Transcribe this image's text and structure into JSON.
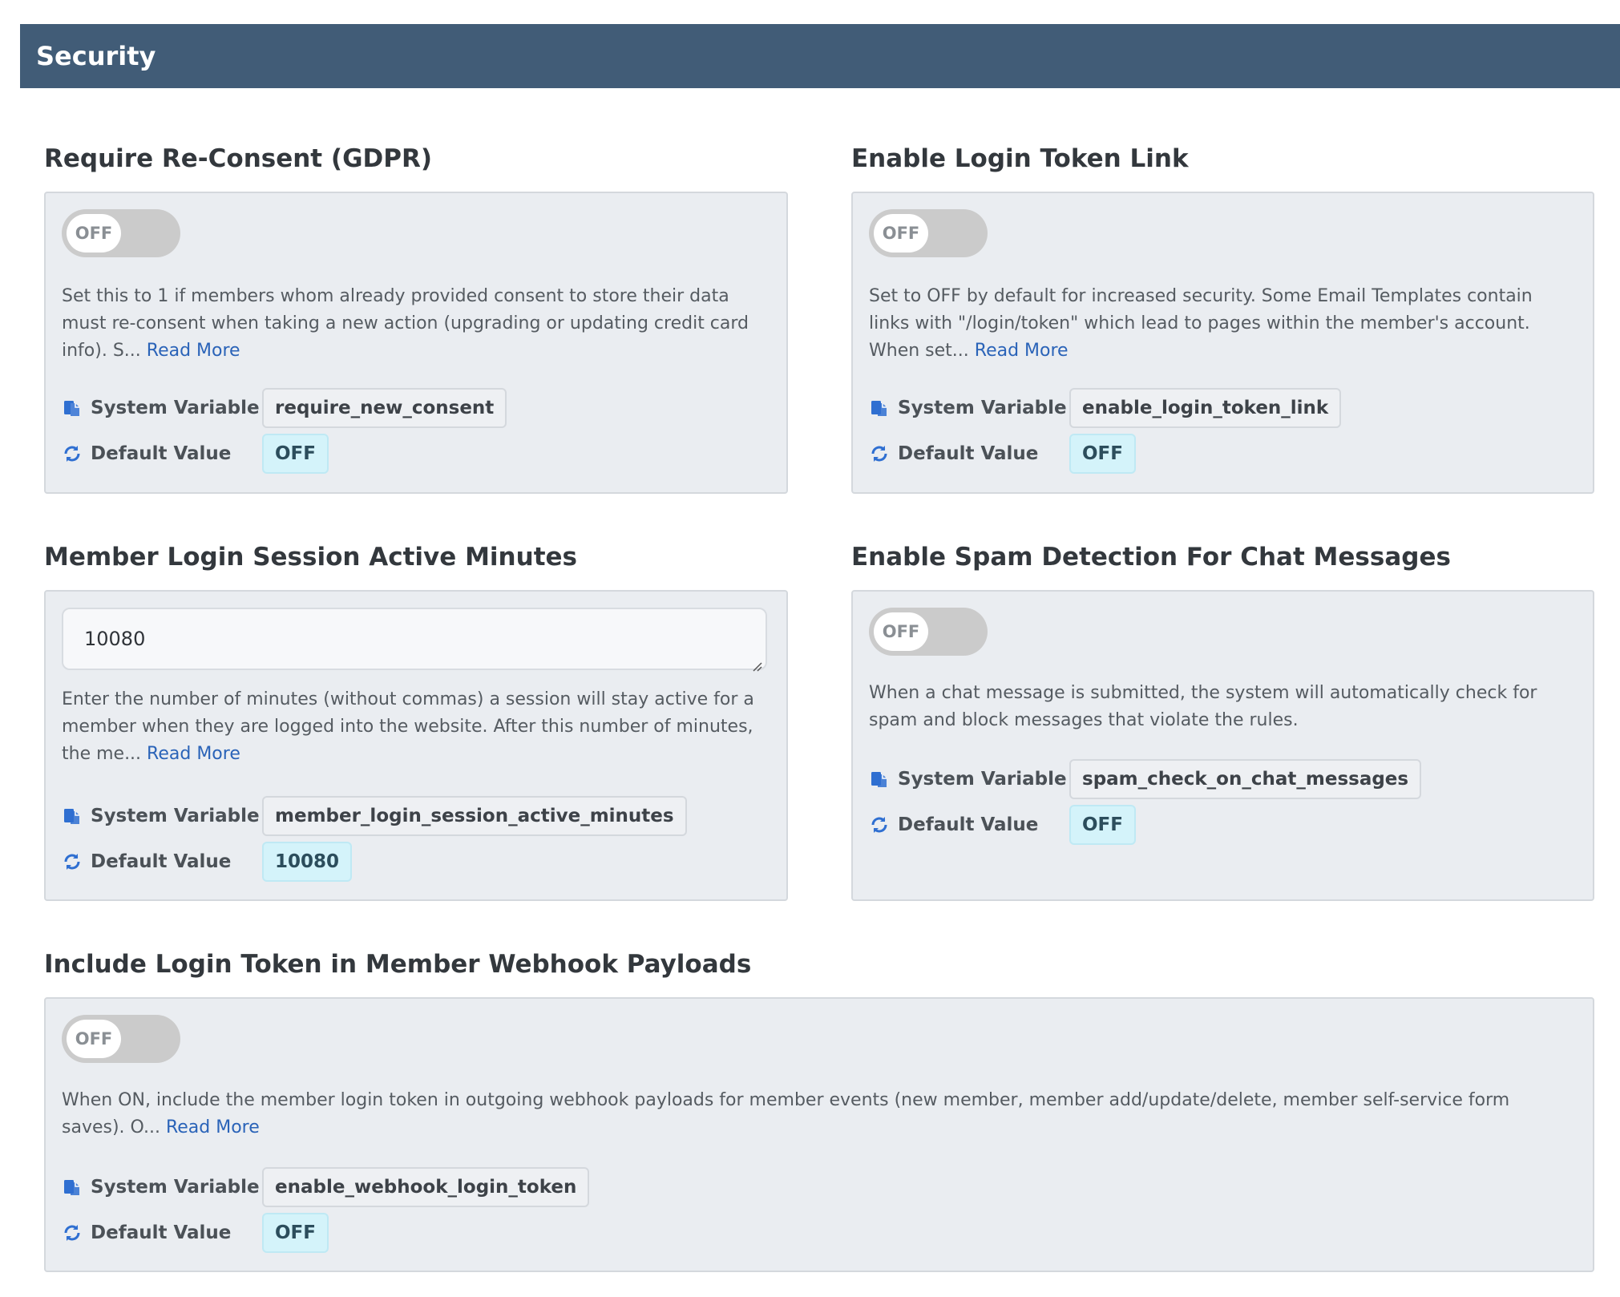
{
  "header": {
    "title": "Security"
  },
  "labels": {
    "system_variable": "System Variable",
    "default_value": "Default Value",
    "read_more": "Read More"
  },
  "settings": [
    {
      "title": "Require Re-Consent (GDPR)",
      "toggle_label": "OFF",
      "description_lines": [
        "Set this to 1 if members whom already provided consent to store their data",
        "must re-consent when taking a new action (upgrading or updating credit card",
        "info).  S..."
      ],
      "system_variable": "require_new_consent",
      "default_value": "OFF"
    },
    {
      "title": "Enable Login Token Link",
      "toggle_label": "OFF",
      "description_lines": [
        "Set to OFF by default for increased security. Some Email Templates contain",
        "links with \"/login/token\" which lead to pages within the member's account.",
        "When set..."
      ],
      "system_variable": "enable_login_token_link",
      "default_value": "OFF"
    },
    {
      "title": "Member Login Session Active Minutes",
      "input_value": "10080",
      "description_lines": [
        "Enter the number of minutes (without commas) a session will stay active for a",
        "member when they are logged into the website. After this number of minutes,",
        "the me..."
      ],
      "system_variable": "member_login_session_active_minutes",
      "default_value": "10080"
    },
    {
      "title": "Enable Spam Detection For Chat Messages",
      "toggle_label": "OFF",
      "description_lines": [
        "When a chat message is submitted, the system will automatically check for",
        "spam and block messages that violate the rules."
      ],
      "system_variable": "spam_check_on_chat_messages",
      "default_value": "OFF"
    },
    {
      "title": "Include Login Token in Member Webhook Payloads",
      "toggle_label": "OFF",
      "description_lines": [
        "When ON, include the member login token in outgoing webhook payloads for member events (new member, member add/update/delete, member self-service form",
        "saves). O..."
      ],
      "system_variable": "enable_webhook_login_token",
      "default_value": "OFF"
    }
  ],
  "colors": {
    "header_bg": "#415c77",
    "card_bg": "#eaedf1",
    "link": "#2a63b8",
    "default_badge_bg": "#d4f3fa"
  }
}
